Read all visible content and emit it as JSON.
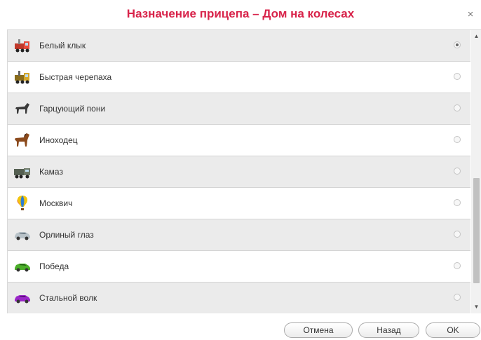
{
  "dialog": {
    "title": "Назначение прицепа – Дом на колесах",
    "close_label": "×"
  },
  "items": [
    {
      "label": "Белый клык",
      "icon": "red-truck-icon",
      "selected": true
    },
    {
      "label": "Быстрая черепаха",
      "icon": "yellow-truck-icon",
      "selected": false
    },
    {
      "label": "Гарцующий пони",
      "icon": "pony-icon",
      "selected": false
    },
    {
      "label": "Иноходец",
      "icon": "horse-icon",
      "selected": false
    },
    {
      "label": "Камаз",
      "icon": "kamaz-truck-icon",
      "selected": false
    },
    {
      "label": "Москвич",
      "icon": "hot-air-balloon-icon",
      "selected": false
    },
    {
      "label": "Орлиный глаз",
      "icon": "gray-car-icon",
      "selected": false
    },
    {
      "label": "Победа",
      "icon": "green-car-icon",
      "selected": false
    },
    {
      "label": "Стальной волк",
      "icon": "purple-car-icon",
      "selected": false
    }
  ],
  "buttons": {
    "cancel": "Отмена",
    "back": "Назад",
    "ok": "OK"
  },
  "colors": {
    "title": "#d8234a",
    "row_alt": "#ebebeb"
  }
}
